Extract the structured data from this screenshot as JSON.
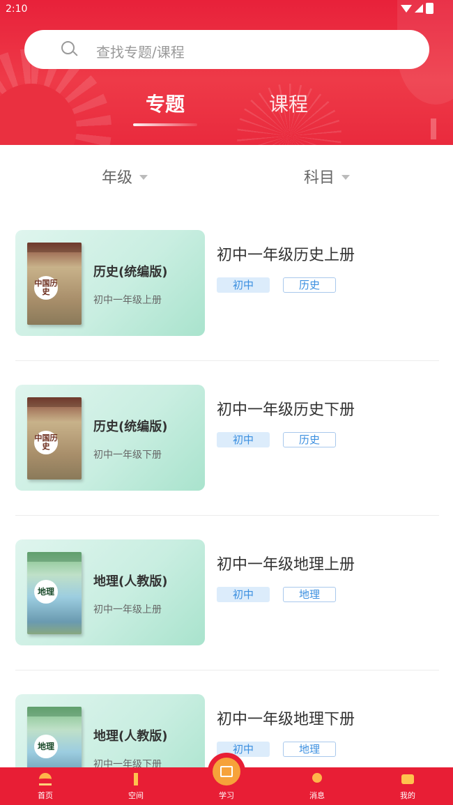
{
  "status_bar": {
    "time": "2:10"
  },
  "search": {
    "placeholder": "查找专题/课程"
  },
  "tabs": [
    {
      "label": "专题",
      "active": true
    },
    {
      "label": "课程",
      "active": false
    }
  ],
  "filters": [
    {
      "label": "年级"
    },
    {
      "label": "科目"
    }
  ],
  "courses": [
    {
      "cover_title": "历史(统编版)",
      "cover_subtitle": "初中一年级上册",
      "cover_badge": "中国历史",
      "title": "初中一年级历史上册",
      "tags": [
        "初中",
        "历史"
      ]
    },
    {
      "cover_title": "历史(统编版)",
      "cover_subtitle": "初中一年级下册",
      "cover_badge": "中国历史",
      "title": "初中一年级历史下册",
      "tags": [
        "初中",
        "历史"
      ]
    },
    {
      "cover_title": "地理(人教版)",
      "cover_subtitle": "初中一年级上册",
      "cover_badge": "地理",
      "title": "初中一年级地理上册",
      "tags": [
        "初中",
        "地理"
      ]
    },
    {
      "cover_title": "地理(人教版)",
      "cover_subtitle": "初中一年级下册",
      "cover_badge": "地理",
      "title": "初中一年级地理下册",
      "tags": [
        "初中",
        "地理"
      ]
    }
  ],
  "bottom_nav": [
    {
      "label": "首页",
      "icon": "home-icon"
    },
    {
      "label": "空间",
      "icon": "space-icon"
    },
    {
      "label": "学习",
      "icon": "study-icon",
      "active": true
    },
    {
      "label": "消息",
      "icon": "message-icon"
    },
    {
      "label": "我的",
      "icon": "profile-icon"
    }
  ],
  "colors": {
    "brand_red": "#e81e35",
    "tag_blue": "#3b8fe0",
    "card_green": "#c9eee1",
    "nav_accent": "#f6a23a"
  }
}
